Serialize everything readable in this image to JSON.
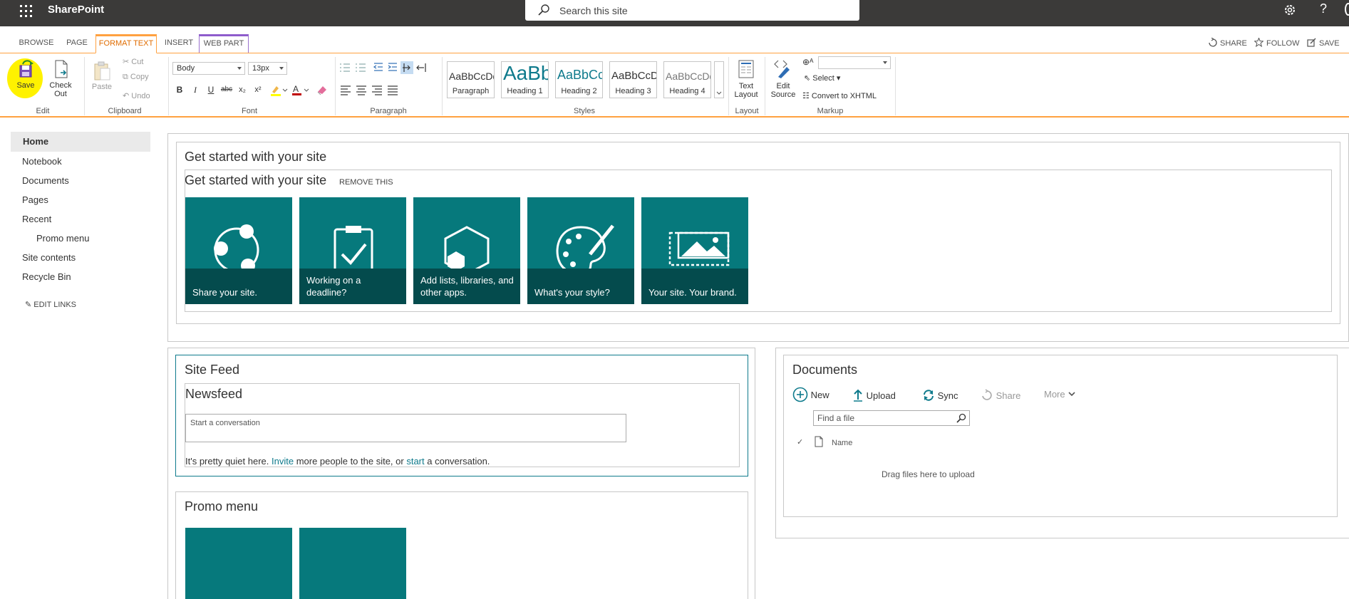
{
  "suite_bar": {
    "brand": "SharePoint",
    "search_placeholder": "Search this site",
    "help": "?"
  },
  "ribbon": {
    "tabs": [
      "BROWSE",
      "PAGE",
      "FORMAT TEXT",
      "INSERT",
      "WEB PART"
    ],
    "active_tab": "FORMAT TEXT",
    "top_actions": {
      "share": "SHARE",
      "follow": "FOLLOW",
      "save": "SAVE"
    },
    "edit": {
      "save": "Save",
      "check_out": "Check Out",
      "group": "Edit"
    },
    "clipboard": {
      "paste": "Paste",
      "cut": "Cut",
      "copy": "Copy",
      "undo": "Undo",
      "group": "Clipboard"
    },
    "font": {
      "style": "Body",
      "size": "13px",
      "bold": "B",
      "italic": "I",
      "underline": "U",
      "strike": "abc",
      "sub": "x₂",
      "sup": "x²",
      "group": "Font"
    },
    "paragraph": {
      "group": "Paragraph"
    },
    "styles": {
      "items": [
        {
          "sample": "AaBbCcDdE",
          "name": "Paragraph"
        },
        {
          "sample": "AaBb",
          "name": "Heading 1"
        },
        {
          "sample": "AaBbCc",
          "name": "Heading 2"
        },
        {
          "sample": "AaBbCcDc",
          "name": "Heading 3"
        },
        {
          "sample": "AaBbCcDdE",
          "name": "Heading 4"
        }
      ],
      "group": "Styles"
    },
    "layout": {
      "text_layout_1": "Text",
      "text_layout_2": "Layout",
      "group": "Layout"
    },
    "markup": {
      "edit_source_1": "Edit",
      "edit_source_2": "Source",
      "select": "Select",
      "convert": "Convert to XHTML",
      "group": "Markup"
    }
  },
  "nav": {
    "items": [
      "Home",
      "Notebook",
      "Documents",
      "Pages",
      "Recent",
      "Promo menu",
      "Site contents",
      "Recycle Bin"
    ],
    "edit_links": "EDIT LINKS"
  },
  "get_started": {
    "zone_title": "Get started with your site",
    "title": "Get started with your site",
    "remove": "REMOVE THIS",
    "tiles": [
      {
        "label": "Share your site.",
        "icon": "share-nodes-icon"
      },
      {
        "label": "Working on a deadline?",
        "icon": "clipboard-check-icon"
      },
      {
        "label": "Add lists, libraries, and other apps.",
        "icon": "hexagon-apps-icon"
      },
      {
        "label": "What's your style?",
        "icon": "palette-icon"
      },
      {
        "label": "Your site. Your brand.",
        "icon": "picture-brand-icon"
      }
    ]
  },
  "site_feed": {
    "title": "Site Feed",
    "newsfeed": "Newsfeed",
    "placeholder": "Start a conversation",
    "quiet_1": "It's pretty quiet here. ",
    "invite": "Invite",
    "quiet_2": " more people to the site, or ",
    "start": "start",
    "quiet_3": " a conversation."
  },
  "documents": {
    "title": "Documents",
    "new": "New",
    "upload": "Upload",
    "sync": "Sync",
    "share": "Share",
    "more": "More",
    "find_placeholder": "Find a file",
    "col_name": "Name",
    "drag": "Drag files here to upload"
  },
  "promo": {
    "title": "Promo menu"
  },
  "colors": {
    "teal": "#06797c",
    "teal_dark": "#044b4d",
    "accent": "#ffa140",
    "suite": "#3b3a39"
  }
}
